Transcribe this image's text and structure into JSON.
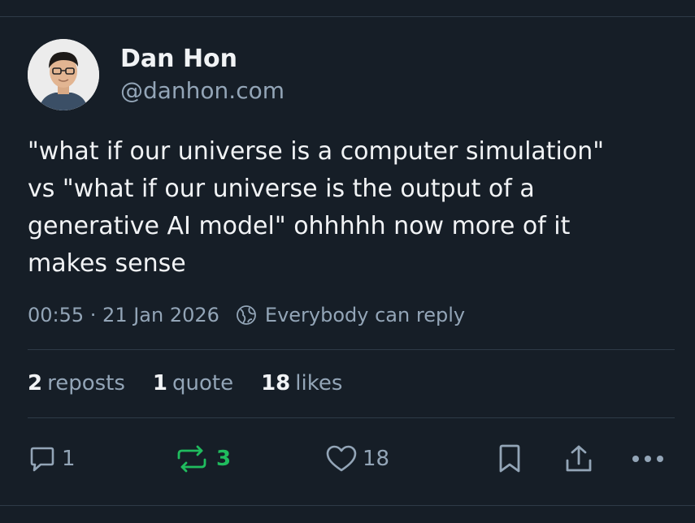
{
  "post": {
    "author": {
      "name": "Dan Hon",
      "handle": "@danhon.com"
    },
    "text_lines": [
      "\"what if our universe is a computer simulation\"",
      "vs \"what if our universe is the output of a",
      "generative AI model\" ohhhhh now more of it",
      "makes sense"
    ],
    "timestamp": "00:55 · 21 Jan 2026",
    "reply_setting": "Everybody can reply"
  },
  "stats": {
    "reposts_count": "2",
    "reposts_label": "reposts",
    "quotes_count": "1",
    "quotes_label": "quote",
    "likes_count": "18",
    "likes_label": "likes"
  },
  "actions": {
    "reply_count": "1",
    "repost_count": "3",
    "like_count": "18"
  },
  "icons": {
    "reply": "reply-icon",
    "repost": "repost-icon",
    "like": "heart-icon",
    "bookmark": "bookmark-icon",
    "share": "share-icon",
    "more": "more-icon",
    "globe": "globe-icon"
  },
  "colors": {
    "background": "#161e27",
    "text": "#f1f3f5",
    "muted": "#93a5b7",
    "repost_active": "#20bc5e",
    "divider": "#2e3a47"
  }
}
